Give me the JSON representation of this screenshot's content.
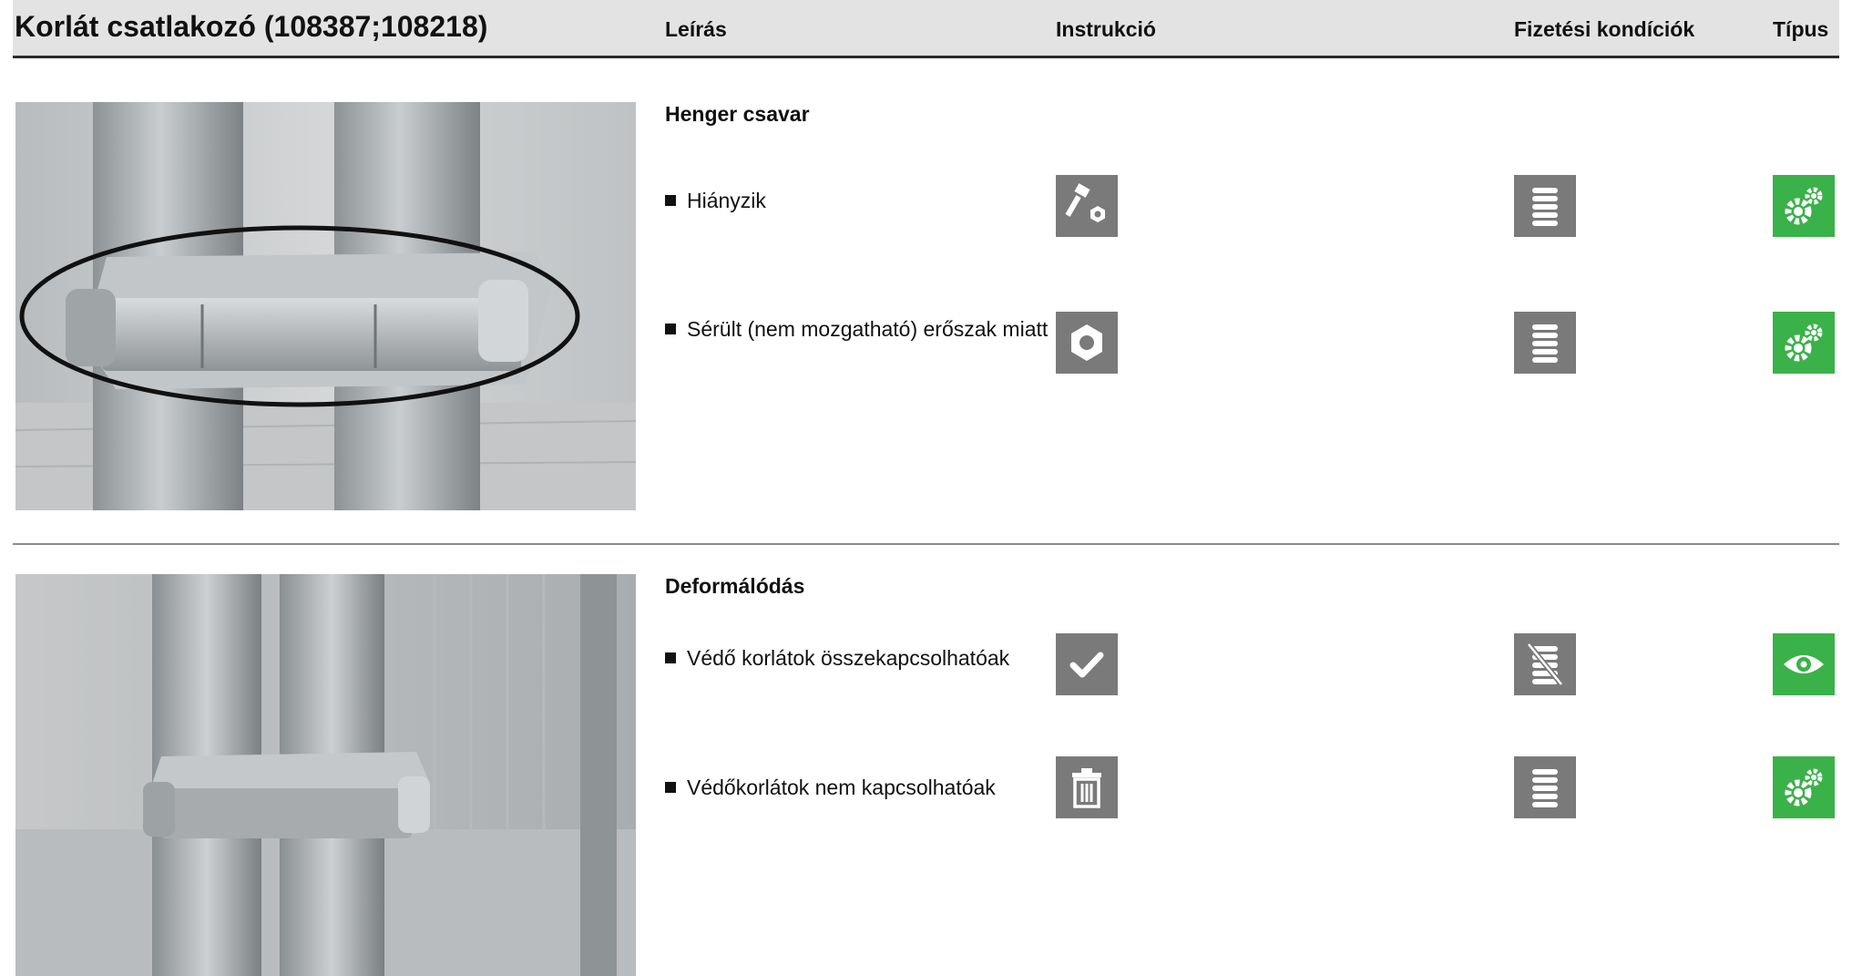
{
  "header": {
    "title": "Korlát csatlakozó (108387;108218)",
    "columns": {
      "description": "Leírás",
      "instruction": "Instrukció",
      "payment": "Fizetési kondíciók",
      "type": "Típus"
    }
  },
  "sections": [
    {
      "heading": "Henger csavar",
      "items": [
        {
          "label": "Hiányzik",
          "instruction_icon": "bolt-nut-icon",
          "payment_icon": "coin-stack-icon",
          "type_icon": "gears-icon"
        },
        {
          "label": "Sérült (nem mozgatható) erőszak miatt",
          "instruction_icon": "nut-icon",
          "payment_icon": "coin-stack-icon",
          "type_icon": "gears-icon"
        }
      ]
    },
    {
      "heading": "Deformálódás",
      "items": [
        {
          "label": "Védő korlátok összekapcsolhatóak",
          "instruction_icon": "checkmark-icon",
          "payment_icon": "coin-stack-crossed-icon",
          "type_icon": "eye-icon"
        },
        {
          "label": "Védőkorlátok nem kapcsolhatóak",
          "instruction_icon": "trash-icon",
          "payment_icon": "coin-stack-icon",
          "type_icon": "gears-icon"
        }
      ]
    }
  ],
  "colors": {
    "icon_grey": "#7a7a7a",
    "icon_green": "#3bb14a",
    "header_bg": "#e3e3e3"
  }
}
